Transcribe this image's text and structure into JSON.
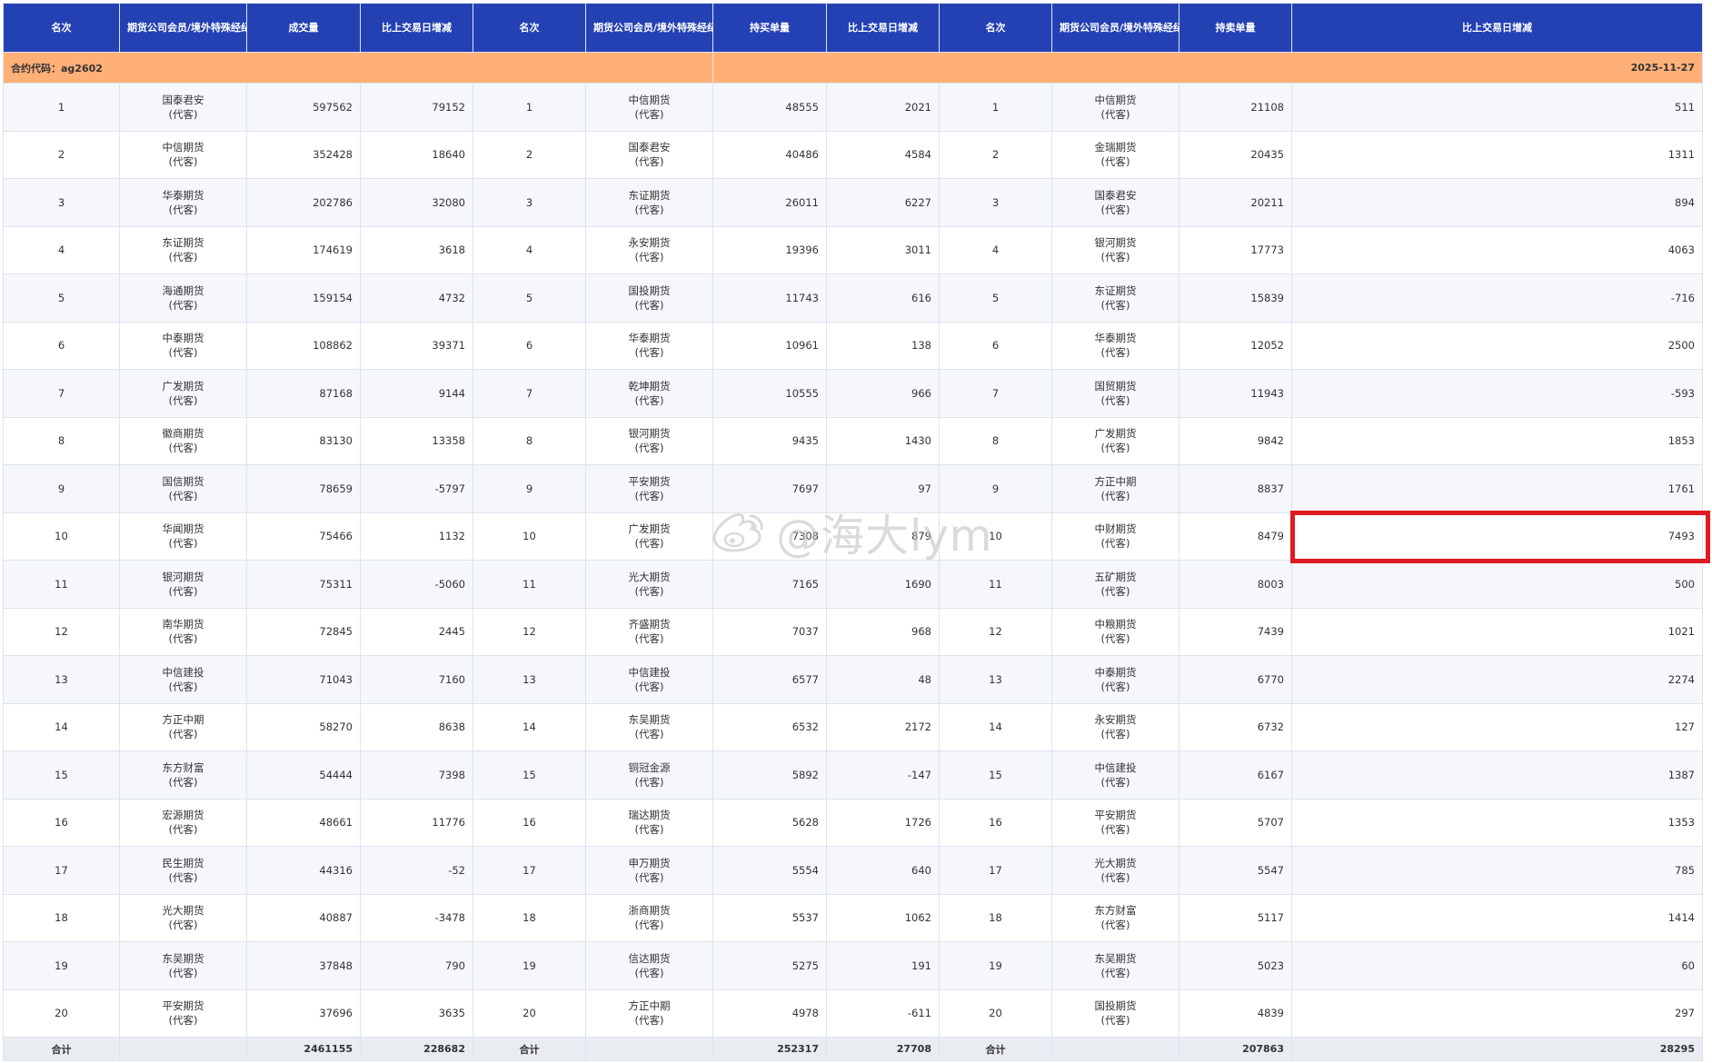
{
  "header": {
    "rank": "名次",
    "member": "期货公司会员/境外特殊经纪参与者简称",
    "volume": "成交量",
    "change": "比上交易日增减",
    "long_oi": "持买单量",
    "short_oi": "持卖单量"
  },
  "contract": {
    "label": "合约代码：ag2602",
    "date": "2025-11-27"
  },
  "client_tag": "(代客)",
  "rows": [
    {
      "rank": "1",
      "vol_name": "国泰君安",
      "volume": "597562",
      "vol_chg": "79152",
      "long_name": "中信期货",
      "long_oi": "48555",
      "long_chg": "2021",
      "short_name": "中信期货",
      "short_oi": "21108",
      "short_chg": "511"
    },
    {
      "rank": "2",
      "vol_name": "中信期货",
      "volume": "352428",
      "vol_chg": "18640",
      "long_name": "国泰君安",
      "long_oi": "40486",
      "long_chg": "4584",
      "short_name": "金瑞期货",
      "short_oi": "20435",
      "short_chg": "1311"
    },
    {
      "rank": "3",
      "vol_name": "华泰期货",
      "volume": "202786",
      "vol_chg": "32080",
      "long_name": "东证期货",
      "long_oi": "26011",
      "long_chg": "6227",
      "short_name": "国泰君安",
      "short_oi": "20211",
      "short_chg": "894"
    },
    {
      "rank": "4",
      "vol_name": "东证期货",
      "volume": "174619",
      "vol_chg": "3618",
      "long_name": "永安期货",
      "long_oi": "19396",
      "long_chg": "3011",
      "short_name": "银河期货",
      "short_oi": "17773",
      "short_chg": "4063"
    },
    {
      "rank": "5",
      "vol_name": "海通期货",
      "volume": "159154",
      "vol_chg": "4732",
      "long_name": "国投期货",
      "long_oi": "11743",
      "long_chg": "616",
      "short_name": "东证期货",
      "short_oi": "15839",
      "short_chg": "-716"
    },
    {
      "rank": "6",
      "vol_name": "中泰期货",
      "volume": "108862",
      "vol_chg": "39371",
      "long_name": "华泰期货",
      "long_oi": "10961",
      "long_chg": "138",
      "short_name": "华泰期货",
      "short_oi": "12052",
      "short_chg": "2500"
    },
    {
      "rank": "7",
      "vol_name": "广发期货",
      "volume": "87168",
      "vol_chg": "9144",
      "long_name": "乾坤期货",
      "long_oi": "10555",
      "long_chg": "966",
      "short_name": "国贸期货",
      "short_oi": "11943",
      "short_chg": "-593"
    },
    {
      "rank": "8",
      "vol_name": "徽商期货",
      "volume": "83130",
      "vol_chg": "13358",
      "long_name": "银河期货",
      "long_oi": "9435",
      "long_chg": "1430",
      "short_name": "广发期货",
      "short_oi": "9842",
      "short_chg": "1853"
    },
    {
      "rank": "9",
      "vol_name": "国信期货",
      "volume": "78659",
      "vol_chg": "-5797",
      "long_name": "平安期货",
      "long_oi": "7697",
      "long_chg": "97",
      "short_name": "方正中期",
      "short_oi": "8837",
      "short_chg": "1761"
    },
    {
      "rank": "10",
      "vol_name": "华闻期货",
      "volume": "75466",
      "vol_chg": "1132",
      "long_name": "广发期货",
      "long_oi": "7308",
      "long_chg": "879",
      "short_name": "中财期货",
      "short_oi": "8479",
      "short_chg": "7493"
    },
    {
      "rank": "11",
      "vol_name": "银河期货",
      "volume": "75311",
      "vol_chg": "-5060",
      "long_name": "光大期货",
      "long_oi": "7165",
      "long_chg": "1690",
      "short_name": "五矿期货",
      "short_oi": "8003",
      "short_chg": "500"
    },
    {
      "rank": "12",
      "vol_name": "南华期货",
      "volume": "72845",
      "vol_chg": "2445",
      "long_name": "齐盛期货",
      "long_oi": "7037",
      "long_chg": "968",
      "short_name": "中粮期货",
      "short_oi": "7439",
      "short_chg": "1021"
    },
    {
      "rank": "13",
      "vol_name": "中信建投",
      "volume": "71043",
      "vol_chg": "7160",
      "long_name": "中信建投",
      "long_oi": "6577",
      "long_chg": "48",
      "short_name": "中泰期货",
      "short_oi": "6770",
      "short_chg": "2274"
    },
    {
      "rank": "14",
      "vol_name": "方正中期",
      "volume": "58270",
      "vol_chg": "8638",
      "long_name": "东吴期货",
      "long_oi": "6532",
      "long_chg": "2172",
      "short_name": "永安期货",
      "short_oi": "6732",
      "short_chg": "127"
    },
    {
      "rank": "15",
      "vol_name": "东方财富",
      "volume": "54444",
      "vol_chg": "7398",
      "long_name": "铜冠金源",
      "long_oi": "5892",
      "long_chg": "-147",
      "short_name": "中信建投",
      "short_oi": "6167",
      "short_chg": "1387"
    },
    {
      "rank": "16",
      "vol_name": "宏源期货",
      "volume": "48661",
      "vol_chg": "11776",
      "long_name": "瑞达期货",
      "long_oi": "5628",
      "long_chg": "1726",
      "short_name": "平安期货",
      "short_oi": "5707",
      "short_chg": "1353"
    },
    {
      "rank": "17",
      "vol_name": "民生期货",
      "volume": "44316",
      "vol_chg": "-52",
      "long_name": "申万期货",
      "long_oi": "5554",
      "long_chg": "640",
      "short_name": "光大期货",
      "short_oi": "5547",
      "short_chg": "785"
    },
    {
      "rank": "18",
      "vol_name": "光大期货",
      "volume": "40887",
      "vol_chg": "-3478",
      "long_name": "浙商期货",
      "long_oi": "5537",
      "long_chg": "1062",
      "short_name": "东方财富",
      "short_oi": "5117",
      "short_chg": "1414"
    },
    {
      "rank": "19",
      "vol_name": "东吴期货",
      "volume": "37848",
      "vol_chg": "790",
      "long_name": "信达期货",
      "long_oi": "5275",
      "long_chg": "191",
      "short_name": "东吴期货",
      "short_oi": "5023",
      "short_chg": "60"
    },
    {
      "rank": "20",
      "vol_name": "平安期货",
      "volume": "37696",
      "vol_chg": "3635",
      "long_name": "方正中期",
      "long_oi": "4978",
      "long_chg": "-611",
      "short_name": "国投期货",
      "short_oi": "4839",
      "short_chg": "297"
    }
  ],
  "totals": {
    "label": "合计",
    "volume": "2461155",
    "vol_chg": "228682",
    "long_oi": "252317",
    "long_chg": "27708",
    "short_oi": "207863",
    "short_chg": "28295"
  },
  "watermark": {
    "text": "@海大lym",
    "icon": "weibo-logo-icon"
  },
  "colors": {
    "header_bg": "#2441b3",
    "contract_bg": "#ffb077",
    "highlight": "#e01a22"
  }
}
